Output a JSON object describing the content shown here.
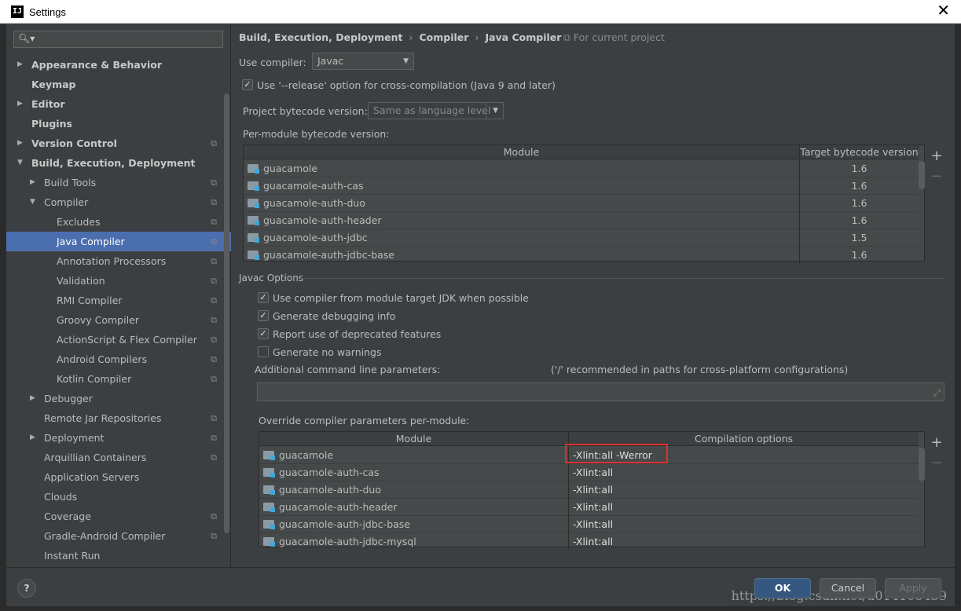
{
  "window": {
    "title": "Settings",
    "app_icon": "IJ"
  },
  "sidebar": {
    "search_placeholder": "",
    "items": [
      {
        "label": "Appearance & Behavior",
        "bold": true,
        "arrow": "right",
        "indent": 0,
        "project": false
      },
      {
        "label": "Keymap",
        "bold": true,
        "arrow": "",
        "indent": 0,
        "project": false
      },
      {
        "label": "Editor",
        "bold": true,
        "arrow": "right",
        "indent": 0,
        "project": false
      },
      {
        "label": "Plugins",
        "bold": true,
        "arrow": "",
        "indent": 0,
        "project": false
      },
      {
        "label": "Version Control",
        "bold": true,
        "arrow": "right",
        "indent": 0,
        "project": true
      },
      {
        "label": "Build, Execution, Deployment",
        "bold": true,
        "arrow": "down",
        "indent": 0,
        "project": false
      },
      {
        "label": "Build Tools",
        "bold": false,
        "arrow": "right",
        "indent": 1,
        "project": true
      },
      {
        "label": "Compiler",
        "bold": false,
        "arrow": "down",
        "indent": 1,
        "project": true
      },
      {
        "label": "Excludes",
        "bold": false,
        "arrow": "",
        "indent": 2,
        "project": true
      },
      {
        "label": "Java Compiler",
        "bold": false,
        "arrow": "",
        "indent": 2,
        "project": true,
        "selected": true
      },
      {
        "label": "Annotation Processors",
        "bold": false,
        "arrow": "",
        "indent": 2,
        "project": true
      },
      {
        "label": "Validation",
        "bold": false,
        "arrow": "",
        "indent": 2,
        "project": true
      },
      {
        "label": "RMI Compiler",
        "bold": false,
        "arrow": "",
        "indent": 2,
        "project": true
      },
      {
        "label": "Groovy Compiler",
        "bold": false,
        "arrow": "",
        "indent": 2,
        "project": true
      },
      {
        "label": "ActionScript & Flex Compiler",
        "bold": false,
        "arrow": "",
        "indent": 2,
        "project": true
      },
      {
        "label": "Android Compilers",
        "bold": false,
        "arrow": "",
        "indent": 2,
        "project": true
      },
      {
        "label": "Kotlin Compiler",
        "bold": false,
        "arrow": "",
        "indent": 2,
        "project": true
      },
      {
        "label": "Debugger",
        "bold": false,
        "arrow": "right",
        "indent": 1,
        "project": false
      },
      {
        "label": "Remote Jar Repositories",
        "bold": false,
        "arrow": "",
        "indent": 1,
        "project": true
      },
      {
        "label": "Deployment",
        "bold": false,
        "arrow": "right",
        "indent": 1,
        "project": true
      },
      {
        "label": "Arquillian Containers",
        "bold": false,
        "arrow": "",
        "indent": 1,
        "project": true
      },
      {
        "label": "Application Servers",
        "bold": false,
        "arrow": "",
        "indent": 1,
        "project": false
      },
      {
        "label": "Clouds",
        "bold": false,
        "arrow": "",
        "indent": 1,
        "project": false
      },
      {
        "label": "Coverage",
        "bold": false,
        "arrow": "",
        "indent": 1,
        "project": true
      },
      {
        "label": "Gradle-Android Compiler",
        "bold": false,
        "arrow": "",
        "indent": 1,
        "project": true
      },
      {
        "label": "Instant Run",
        "bold": false,
        "arrow": "",
        "indent": 1,
        "project": false
      }
    ]
  },
  "breadcrumb": [
    "Build, Execution, Deployment",
    "Compiler",
    "Java Compiler"
  ],
  "for_project": "For current project",
  "use_compiler": {
    "label": "Use compiler:",
    "value": "Javac"
  },
  "release_option": {
    "label": "Use '--release' option for cross-compilation (Java 9 and later)",
    "checked": true
  },
  "project_bytecode": {
    "label": "Project bytecode version:",
    "value": "Same as language level"
  },
  "per_module": {
    "label": "Per-module bytecode version:",
    "columns": [
      "Module",
      "Target bytecode version"
    ],
    "rows": [
      {
        "module": "guacamole",
        "version": "1.6"
      },
      {
        "module": "guacamole-auth-cas",
        "version": "1.6"
      },
      {
        "module": "guacamole-auth-duo",
        "version": "1.6"
      },
      {
        "module": "guacamole-auth-header",
        "version": "1.6"
      },
      {
        "module": "guacamole-auth-jdbc",
        "version": "1.5"
      },
      {
        "module": "guacamole-auth-jdbc-base",
        "version": "1.6"
      }
    ]
  },
  "javac_options": {
    "title": "Javac Options",
    "checks": [
      {
        "label": "Use compiler from module target JDK when possible",
        "checked": true
      },
      {
        "label": "Generate debugging info",
        "checked": true
      },
      {
        "label": "Report use of deprecated features",
        "checked": true
      },
      {
        "label": "Generate no warnings",
        "checked": false
      }
    ],
    "additional_label": "Additional command line parameters:",
    "additional_hint": "('/' recommended in paths for cross-platform configurations)",
    "additional_value": ""
  },
  "override": {
    "label": "Override compiler parameters per-module:",
    "columns": [
      "Module",
      "Compilation options"
    ],
    "rows": [
      {
        "module": "guacamole",
        "options": "-Xlint:all -Werror",
        "highlight": true
      },
      {
        "module": "guacamole-auth-cas",
        "options": "-Xlint:all"
      },
      {
        "module": "guacamole-auth-duo",
        "options": "-Xlint:all"
      },
      {
        "module": "guacamole-auth-header",
        "options": "-Xlint:all"
      },
      {
        "module": "guacamole-auth-jdbc-base",
        "options": "-Xlint:all"
      },
      {
        "module": "guacamole-auth-jdbc-mysql",
        "options": "-Xlint:all"
      }
    ]
  },
  "table_buttons": {
    "add": "+",
    "remove": "−"
  },
  "footer": {
    "help": "?",
    "ok": "OK",
    "cancel": "Cancel",
    "apply": "Apply",
    "watermark": "https://blog.csdn.net/u014108439"
  }
}
